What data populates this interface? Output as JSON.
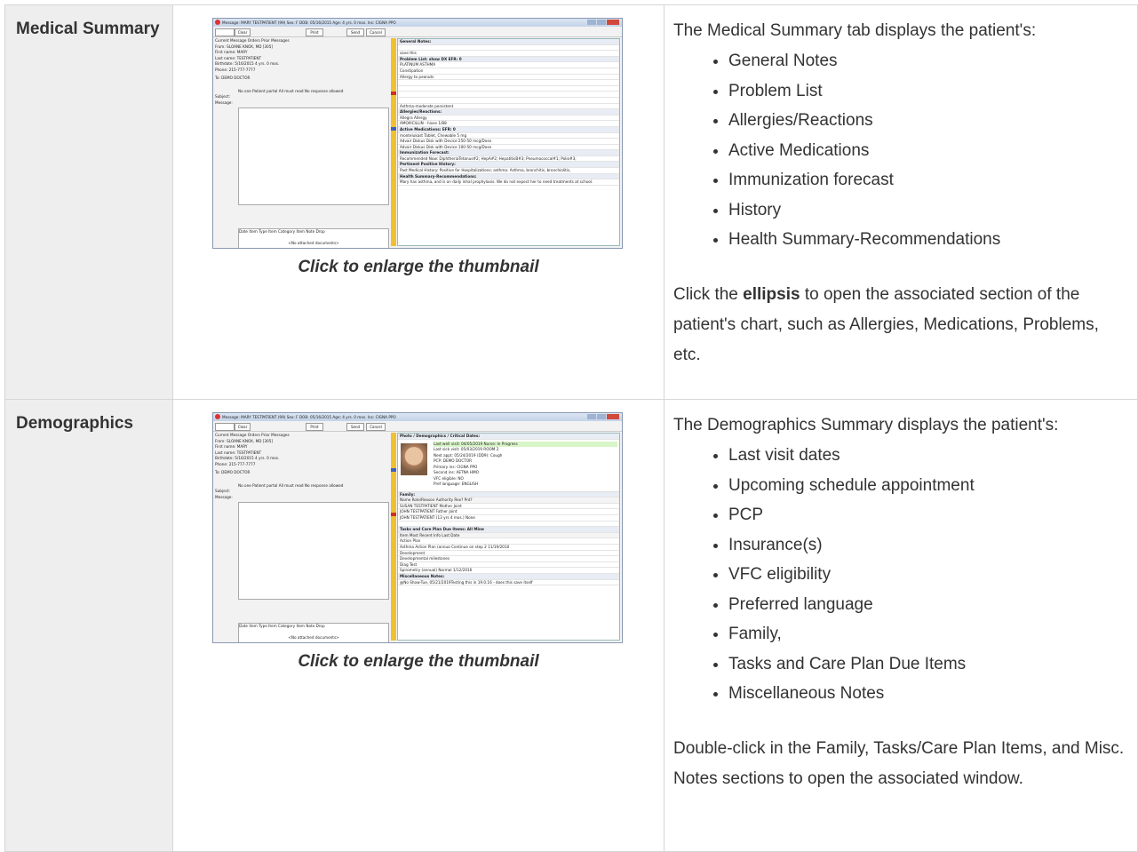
{
  "rows": [
    {
      "label": "Medical Summary",
      "caption": "Click to enlarge the thumbnail",
      "intro": "The Medical Summary tab displays the patient's:",
      "items": [
        "General Notes",
        "Problem List",
        "Allergies/Reactions",
        "Active Medications",
        "Immunization forecast",
        "History",
        "Health Summary-Recommendations"
      ],
      "note_pre": "Click the ",
      "note_bold": "ellipsis",
      "note_post": " to open the associated section of the patient's chart, such as Allergies, Medications, Problems, etc."
    },
    {
      "label": "Demographics",
      "caption": "Click to enlarge the thumbnail",
      "intro": "The Demographics Summary displays the patient's:",
      "items": [
        "Last visit dates",
        "Upcoming schedule appointment",
        "PCP",
        "Insurance(s)",
        "VFC eligibility",
        "Preferred language",
        "Family,",
        "Tasks and Care Plan Due Items",
        "Miscellaneous Notes"
      ],
      "note": "Double-click in the Family, Tasks/Care Plan Items, and Misc. Notes sections to open the associated window."
    }
  ],
  "thumb": {
    "title": "Message: MARY TESTPATIENT (99)  Sex: F  DOB: 05/16/2015  Age: 4 yrs. 0 mos.  Ins: CIGNA PPO",
    "clear": "Clear",
    "print": "Print",
    "send": "Send",
    "cancel": "Cancel",
    "tabs": "Current Message   Orders   Prior Messages",
    "from": "From:   SLOANE KNOX, MD [305]",
    "first": "First name:  MARY",
    "last": "Last name:  TESTPATIENT",
    "birth": "Birthdate:  5/16/2015     4 yrs. 0 mos.",
    "phone": "Phone:  215-777-7777",
    "to": "To:   DEMO DOCTOR",
    "checks": "No one   Patient portal   All must read   No response allowed",
    "subject": "Subject:",
    "message": "Message:",
    "attach": "Date        Item Type        Item Category      Item Note   Drop",
    "noattach": "<No attached documents>",
    "med": [
      "General Notes:",
      "save this",
      "Problem List:   show DX  EFR: 0",
      "PLATINUM ASTHMA",
      "Constipation",
      "Allergy to peanuts",
      "",
      "",
      "Asthma-moderate persistent",
      "Allergies/Reactions:",
      "Allegra Allergy",
      "AMOXICILLIN - hives  1/88",
      "Active Medications:      EFR: 0",
      "montelukast Tablet, Chewable 5 mg",
      "Advair Diskus Disk with Device 250-50 mcg/Dose",
      "Advair Diskus Disk with Device 100-50 mcg/Dose",
      "Immunization Forecast:",
      "Recommended Now: DiphtheriaTetanus#2;  HepA#2;  HepatitisB#3;  Pneumococcal#1;  Polio#3;",
      "Pertinent Positive History:",
      "Past Medical History: Positive for Hospitalizations; asthma: Asthma, bronchitis, bronchiolitis,",
      "Health Summary-Recommendations:",
      "Mary has asthma, and is on daily inhal prophylaxis. We do not expect her to need treatments at school."
    ],
    "demo_head": "Photo / Demographics / Critical Dates:",
    "demo": [
      "Last well visit:  04/05/2019  Nurse: In Progress",
      "Last sick visit:  05/03/2019  ROOM 2",
      "Next appt:  05/24/2019 (DD9): Cough",
      "PCP:  DEMO DOCTOR",
      "Primary ins:  CIGNA PPO",
      "Second ins:  AETNA HMO",
      "VFC eligible:  NO",
      "Pref language:  ENGLISH"
    ],
    "family": [
      "Family:",
      "Name                         Role/Reason     Authority   Rex?   Pnt?",
      "SUSAN  TESTPATIENT              Mother          Joint",
      "JOHN  TESTPATIENT                Father          Joint",
      "JOHN  TESTPATIENT (13 yrs 4 mos.)                 None"
    ],
    "tasks": [
      "Tasks and Care Plan Due Items:   All   Mine",
      "Item                     Most Recent Info           Last Date",
      "Action Plan",
      "Asthma Action Plan (annua   Continue on step 2          11/19/2010",
      "Development",
      "Developmental milestones",
      "Diag Test",
      "Spirometry (annual)        Normal                     1/12/2016",
      "Miscellaneous Notes:",
      "@No Show-Tue, 05/21/2019Testing this in 19.0.16 - does this save itself"
    ]
  }
}
